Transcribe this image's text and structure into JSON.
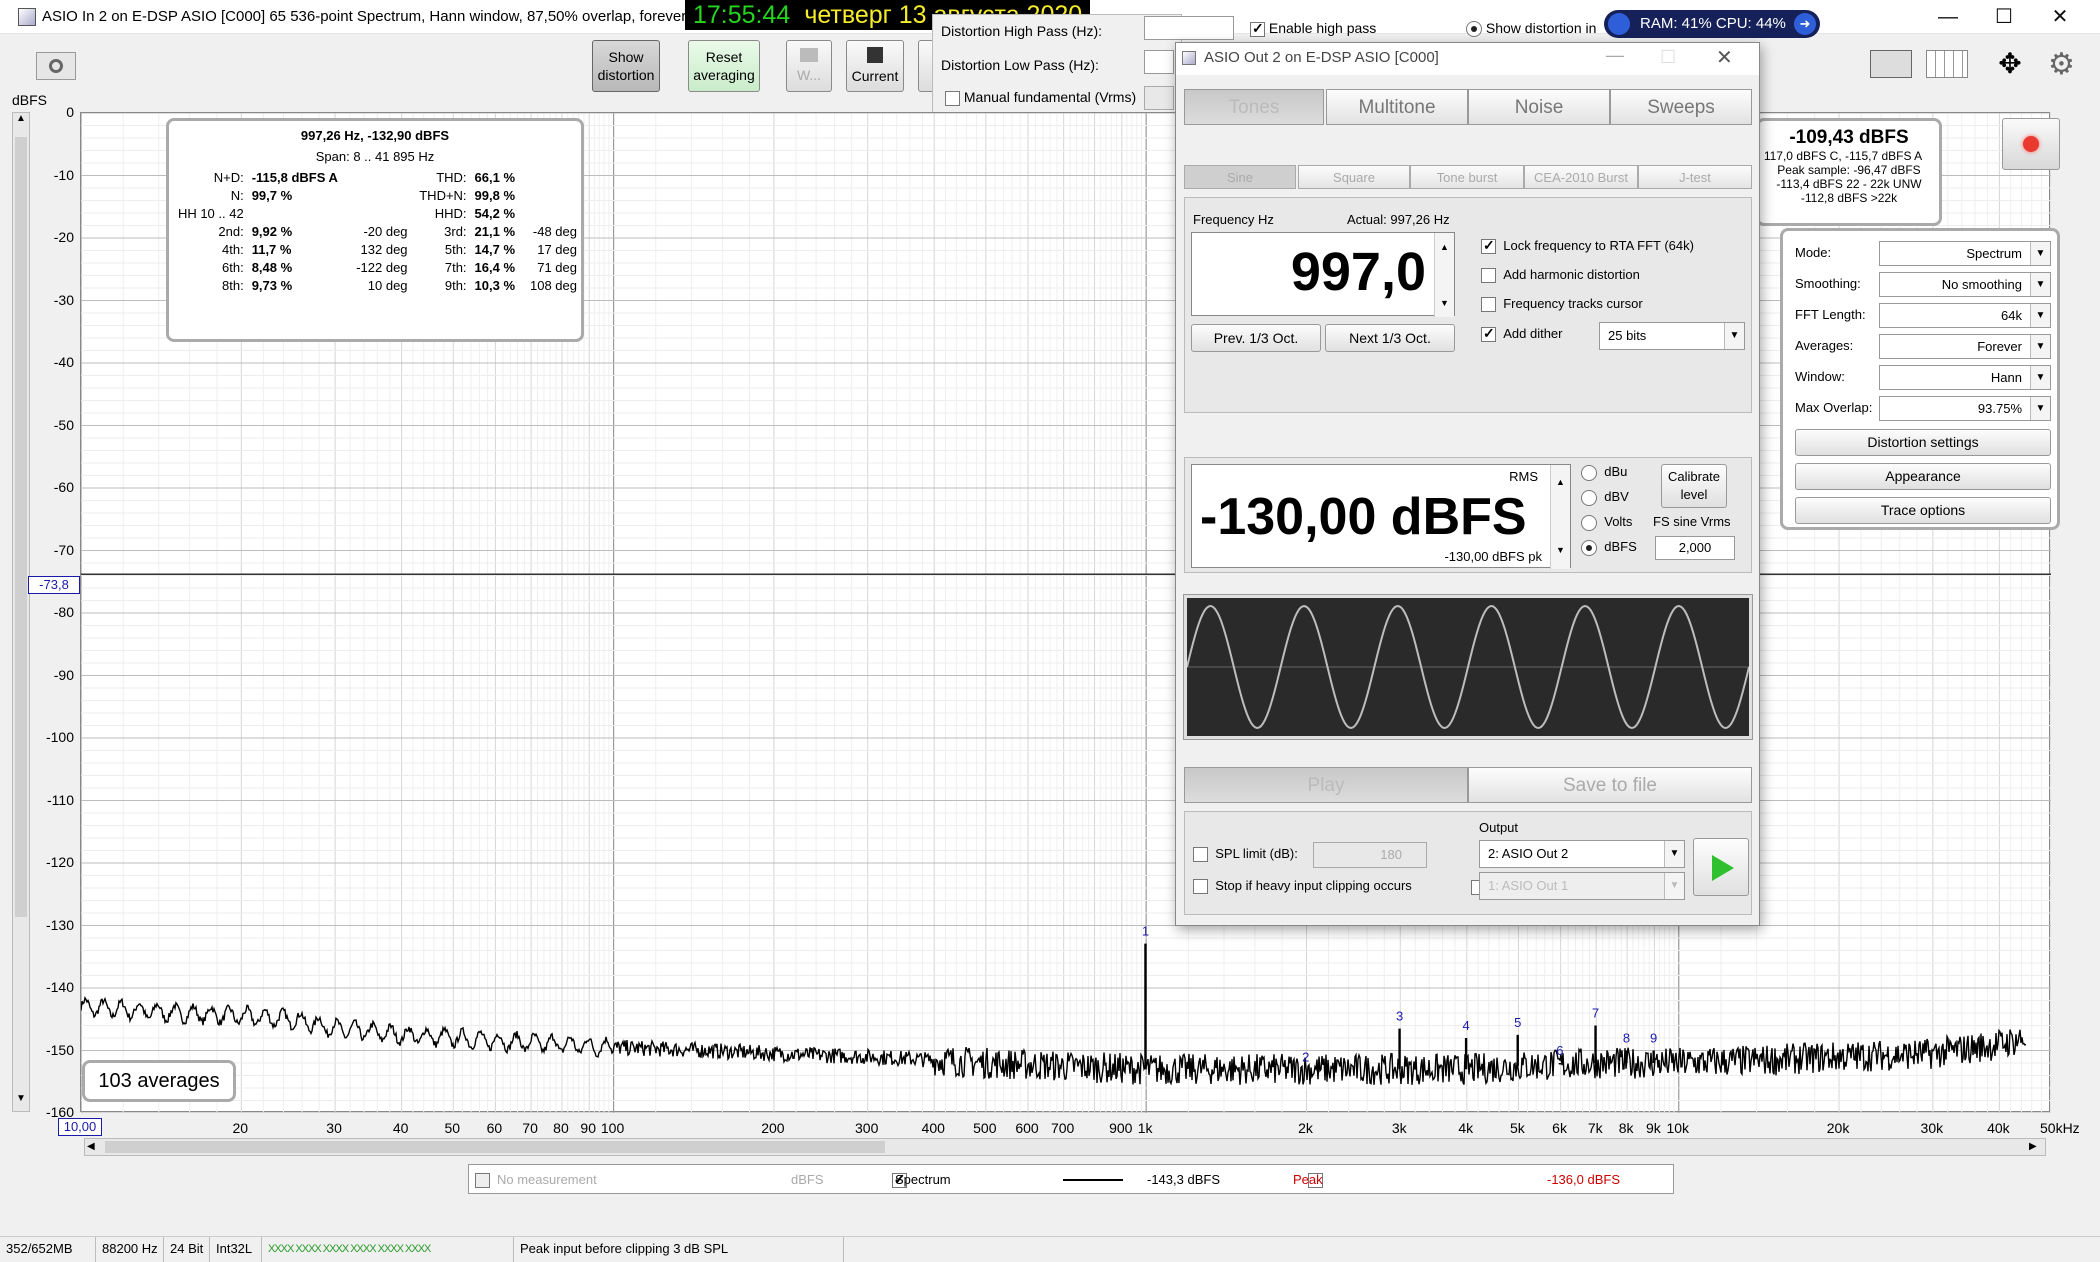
{
  "titlebar": {
    "title": "ASIO In 2 on E-DSP ASIO [C000] 65 536-point Spectrum, Hann window, 87,50% overlap, forever av"
  },
  "clock": {
    "time": "17:55:44",
    "date": "четверг 13 августа 2020"
  },
  "sysmon": {
    "text": "RAM: 41% CPU: 44%"
  },
  "toolbar": {
    "show_distortion": [
      "Show",
      "distortion"
    ],
    "reset_averaging": [
      "Reset",
      "averaging"
    ],
    "w_label": "W...",
    "current_label": "Current"
  },
  "distortion_panel": {
    "high_pass_label": "Distortion High Pass (Hz):",
    "low_pass_label": "Distortion Low Pass (Hz):",
    "manual_fundamental": "Manual fundamental (Vrms)",
    "enable_high_pass": "Enable high pass",
    "show_distortion_in": "Show distortion in"
  },
  "graph": {
    "y_unit": "dBFS",
    "y_ticks": [
      "0",
      "-10",
      "-20",
      "-30",
      "-40",
      "-50",
      "-60",
      "-70",
      "-80",
      "-90",
      "-100",
      "-110",
      "-120",
      "-130",
      "-140",
      "-150",
      "-160"
    ],
    "cursor_level": "-73,8",
    "x_start": "10,00",
    "x_ticks": [
      {
        "f": 20,
        "l": "20"
      },
      {
        "f": 30,
        "l": "30"
      },
      {
        "f": 40,
        "l": "40"
      },
      {
        "f": 50,
        "l": "50"
      },
      {
        "f": 60,
        "l": "60"
      },
      {
        "f": 70,
        "l": "70"
      },
      {
        "f": 80,
        "l": "80"
      },
      {
        "f": 90,
        "l": "90"
      },
      {
        "f": 100,
        "l": "100"
      },
      {
        "f": 200,
        "l": "200"
      },
      {
        "f": 300,
        "l": "300"
      },
      {
        "f": 400,
        "l": "400"
      },
      {
        "f": 500,
        "l": "500"
      },
      {
        "f": 600,
        "l": "600"
      },
      {
        "f": 700,
        "l": "700"
      },
      {
        "f": 900,
        "l": "900"
      },
      {
        "f": 1000,
        "l": "1k"
      },
      {
        "f": 2000,
        "l": "2k"
      },
      {
        "f": 3000,
        "l": "3k"
      },
      {
        "f": 4000,
        "l": "4k"
      },
      {
        "f": 5000,
        "l": "5k"
      },
      {
        "f": 6000,
        "l": "6k"
      },
      {
        "f": 7000,
        "l": "7k"
      },
      {
        "f": 8000,
        "l": "8k"
      },
      {
        "f": 9000,
        "l": "9k"
      },
      {
        "f": 10000,
        "l": "10k"
      },
      {
        "f": 20000,
        "l": "20k"
      },
      {
        "f": 30000,
        "l": "30k"
      },
      {
        "f": 40000,
        "l": "40k"
      }
    ],
    "x_end": "50kHz",
    "averages": "103 averages"
  },
  "chart_data": {
    "type": "line",
    "xscale": "log",
    "xlim": [
      10,
      50000
    ],
    "ylim": [
      -160,
      0
    ],
    "ylabel": "dBFS",
    "series": [
      {
        "name": "Spectrum",
        "x": [
          10,
          15,
          20,
          25,
          30,
          35,
          40,
          50,
          60,
          80,
          100,
          150,
          200,
          300,
          400,
          500,
          700,
          1000,
          1500,
          2000,
          3000,
          4000,
          5000,
          7000,
          10000,
          15000,
          20000,
          30000,
          40000,
          45000
        ],
        "y": [
          -143,
          -144,
          -144.5,
          -145,
          -146.5,
          -147,
          -147.5,
          -148,
          -148.5,
          -149,
          -149.5,
          -150,
          -150.5,
          -151,
          -151.5,
          -152,
          -152.5,
          -153,
          -153,
          -153,
          -153,
          -153,
          -152.5,
          -152,
          -152,
          -151.5,
          -151,
          -150.5,
          -149,
          -148
        ]
      }
    ],
    "peaks": [
      {
        "label": "1",
        "f": 997,
        "db": -132.9
      },
      {
        "label": "2",
        "f": 1994,
        "db": -153
      },
      {
        "label": "3",
        "f": 2991,
        "db": -146.5
      },
      {
        "label": "4",
        "f": 3988,
        "db": -148
      },
      {
        "label": "5",
        "f": 4985,
        "db": -147.5
      },
      {
        "label": "6",
        "f": 5982,
        "db": -152
      },
      {
        "label": "7",
        "f": 6979,
        "db": -146
      },
      {
        "label": "8",
        "f": 7976,
        "db": -150
      },
      {
        "label": "9",
        "f": 8973,
        "db": -150
      }
    ]
  },
  "distortion_overlay": {
    "header": "997,26 Hz, -132,90 dBFS",
    "span": "Span: 8 .. 41 895 Hz",
    "rows": [
      [
        "N+D:",
        "-115,8 dBFS A",
        "THD:",
        "66,1 %",
        ""
      ],
      [
        "N:",
        "99,7 %",
        "THD+N:",
        "99,8 %",
        ""
      ],
      [
        "HH 10 .. 42",
        "",
        "HHD:",
        "54,2 %",
        ""
      ]
    ],
    "harmonics": [
      [
        "2nd:",
        "9,92 %",
        "-20 deg",
        "3rd:",
        "21,1 %",
        "-48 deg"
      ],
      [
        "4th:",
        "11,7 %",
        "132 deg",
        "5th:",
        "14,7 %",
        "17 deg"
      ],
      [
        "6th:",
        "8,48 %",
        "-122 deg",
        "7th:",
        "16,4 %",
        "71 deg"
      ],
      [
        "8th:",
        "9,73 %",
        "10 deg",
        "9th:",
        "10,3 %",
        "108 deg"
      ]
    ]
  },
  "level_overlay": {
    "main": "-109,43 dBFS",
    "lines": [
      "117,0 dBFS C, -115,7 dBFS A",
      "Peak sample: -96,47 dBFS",
      "-113,4 dBFS 22 - 22k UNW",
      "-112,8 dBFS >22k"
    ]
  },
  "settings_panel": {
    "rows": [
      {
        "label": "Mode:",
        "value": "Spectrum"
      },
      {
        "label": "Smoothing:",
        "value": "No  smoothing"
      },
      {
        "label": "FFT Length:",
        "value": "64k"
      },
      {
        "label": "Averages:",
        "value": "Forever"
      },
      {
        "label": "Window:",
        "value": "Hann"
      },
      {
        "label": "Max Overlap:",
        "value": "93.75%"
      }
    ],
    "buttons": [
      "Distortion settings",
      "Appearance",
      "Trace options"
    ]
  },
  "generator": {
    "title": "ASIO Out 2 on E-DSP ASIO [C000]",
    "tabs": [
      "Tones",
      "Multitone",
      "Noise",
      "Sweeps"
    ],
    "subtabs": [
      "Sine",
      "Square",
      "Tone burst",
      "CEA-2010 Burst",
      "J-test"
    ],
    "freq_label": "Frequency Hz",
    "actual": "Actual: 997,26 Hz",
    "freq_value": "997,0",
    "prev_oct": "Prev. 1/3 Oct.",
    "next_oct": "Next 1/3 Oct.",
    "lock_freq": "Lock frequency to RTA FFT (64k)",
    "add_harmonic": "Add harmonic distortion",
    "freq_tracks": "Frequency tracks cursor",
    "add_dither": "Add dither",
    "dither_bits": "25 bits",
    "rms_label": "RMS",
    "level_value": "-130,00 dBFS",
    "level_pk": "-130,00 dBFS pk",
    "units": [
      "dBu",
      "dBV",
      "Volts",
      "dBFS"
    ],
    "calibrate": [
      "Calibrate",
      "level"
    ],
    "fs_sine_label": "FS sine Vrms",
    "fs_sine_value": "2,000",
    "play": "Play",
    "save_to_file": "Save to file",
    "spl_limit": "SPL limit (dB):",
    "spl_value": "180",
    "stop_clipping": "Stop if heavy input clipping occurs",
    "output_label": "Output",
    "output_value": "2: ASIO Out 2",
    "output2_value": "1: ASIO Out 1"
  },
  "legend": {
    "no_measurement": "No measurement",
    "unit1": "dBFS",
    "spectrum": "Spectrum",
    "spectrum_val": "-143,3 dBFS",
    "peak": "Peak",
    "peak_val": "-136,0 dBFS"
  },
  "statusbar": {
    "mem": "352/652MB",
    "rate": "88200 Hz",
    "bits": "24 Bit",
    "format": "Int32L",
    "meters": "XXXX XXXX  XXXX XXXX  XXXX XXXX",
    "peak_msg": "Peak input before clipping 3 dB SPL"
  },
  "colors": {
    "accent_green": "#24d61d",
    "date_yellow": "#f5ec2a",
    "peak_red": "#cc0000",
    "trace": "#000000",
    "label_blue": "#1a1aaa"
  }
}
